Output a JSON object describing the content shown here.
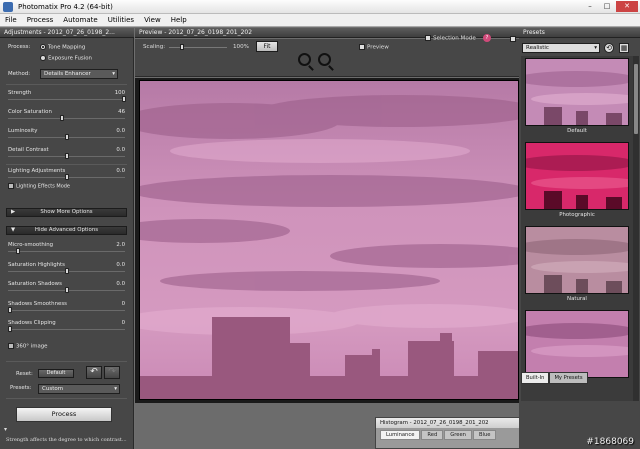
{
  "window": {
    "title": "Photomatix Pro 4.2 (64-bit)"
  },
  "menu": [
    "File",
    "Process",
    "Automate",
    "Utilities",
    "View",
    "Help"
  ],
  "adjustments": {
    "header": "Adjustments - 2012_07_26_0198_2...",
    "process_label": "Process:",
    "process_options": [
      "Tone Mapping",
      "Exposure Fusion"
    ],
    "method_label": "Method:",
    "method_value": "Details Enhancer",
    "sliders": [
      {
        "label": "Strength",
        "value": "100",
        "level": 1.0
      },
      {
        "label": "Color Saturation",
        "value": "46",
        "level": 0.46
      },
      {
        "label": "Luminosity",
        "value": "0.0",
        "level": 0.5
      },
      {
        "label": "Detail Contrast",
        "value": "0.0",
        "level": 0.5
      },
      {
        "label": "Lighting Adjustments",
        "value": "0.0",
        "level": 0.5
      }
    ],
    "lighting_effects_mode": "Lighting Effects Mode",
    "show_more": "Show More Options",
    "hide_advanced": "Hide Advanced Options",
    "advanced_sliders": [
      {
        "label": "Micro-smoothing",
        "value": "2.0",
        "level": 0.07
      },
      {
        "label": "Saturation Highlights",
        "value": "0.0",
        "level": 0.5
      },
      {
        "label": "Saturation Shadows",
        "value": "0.0",
        "level": 0.5
      },
      {
        "label": "Shadows Smoothness",
        "value": "0",
        "level": 0.0
      },
      {
        "label": "Shadows Clipping",
        "value": "0",
        "level": 0.0
      }
    ],
    "image_360": "360° image",
    "reset_label": "Reset:",
    "default_btn": "Default",
    "presets_label": "Presets:",
    "presets_value": "Custom",
    "process_btn": "Process",
    "help_text": "Strength affects the degree to which contrast..."
  },
  "preview": {
    "header": "Preview - 2012_07_26_0198_201_202",
    "scaling_label": "Scaling:",
    "scaling_value": "100%",
    "scaling_level": 0.2,
    "fit_btn": "Fit",
    "preview_check": "Preview",
    "selection_mode": "Selection Mode"
  },
  "presets": {
    "header": "Presets",
    "dropdown": "Realistic",
    "items": [
      "Default",
      "Photographic",
      "Natural",
      ""
    ],
    "tabs": [
      "Built-In",
      "My Presets"
    ]
  },
  "histogram": {
    "header": "Histogram - 2012_07_26_0198_201_202",
    "tabs": [
      "Luminance",
      "Red",
      "Green",
      "Blue"
    ]
  },
  "watermark": "#1868069",
  "colors": {
    "panel": "#474747",
    "sky": "#c98ab6",
    "photographic": "#d8286a"
  }
}
